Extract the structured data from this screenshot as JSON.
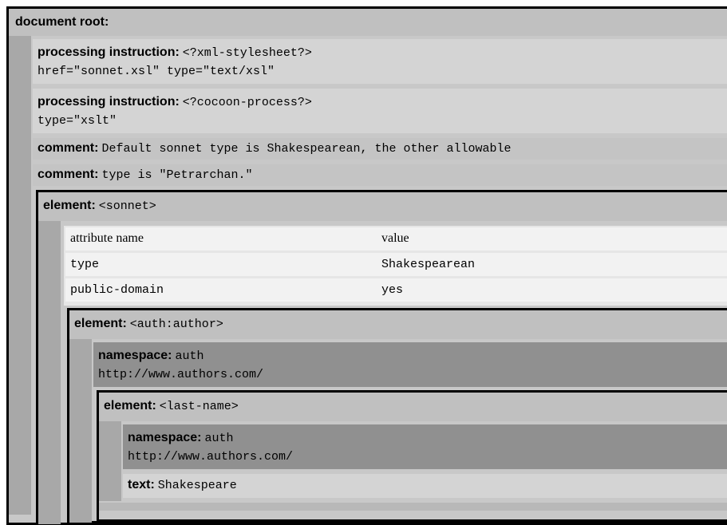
{
  "root": {
    "label": "document root:",
    "pi1": {
      "label": "processing instruction:",
      "target": "<?xml-stylesheet?>",
      "data": "href=\"sonnet.xsl\" type=\"text/xsl\""
    },
    "pi2": {
      "label": "processing instruction:",
      "target": "<?cocoon-process?>",
      "data": "type=\"xslt\""
    },
    "comment1": {
      "label": "comment:",
      "text": "Default sonnet type is Shakespearean, the other allowable"
    },
    "comment2": {
      "label": "comment:",
      "text": "type is \"Petrarchan.\""
    },
    "sonnet": {
      "label": "element:",
      "tag": "<sonnet>",
      "attr_table": {
        "col_name": "attribute name",
        "col_value": "value",
        "rows": [
          {
            "name": "type",
            "value": "Shakespearean"
          },
          {
            "name": "public-domain",
            "value": "yes"
          }
        ]
      },
      "author": {
        "label": "element:",
        "tag": "<auth:author>",
        "ns": {
          "label": "namespace:",
          "prefix": "auth",
          "uri": "http://www.authors.com/"
        },
        "lastname": {
          "label": "element:",
          "tag": "<last-name>",
          "ns": {
            "label": "namespace:",
            "prefix": "auth",
            "uri": "http://www.authors.com/"
          },
          "text": {
            "label": "text:",
            "value": "Shakespeare"
          }
        }
      }
    }
  },
  "colors": {
    "frame": "#000000",
    "level1": "#c0c0c0",
    "level2": "#a8a8a8",
    "namespace": "#909090",
    "light": "#d8d8d8",
    "table": "#f2f2f2"
  }
}
